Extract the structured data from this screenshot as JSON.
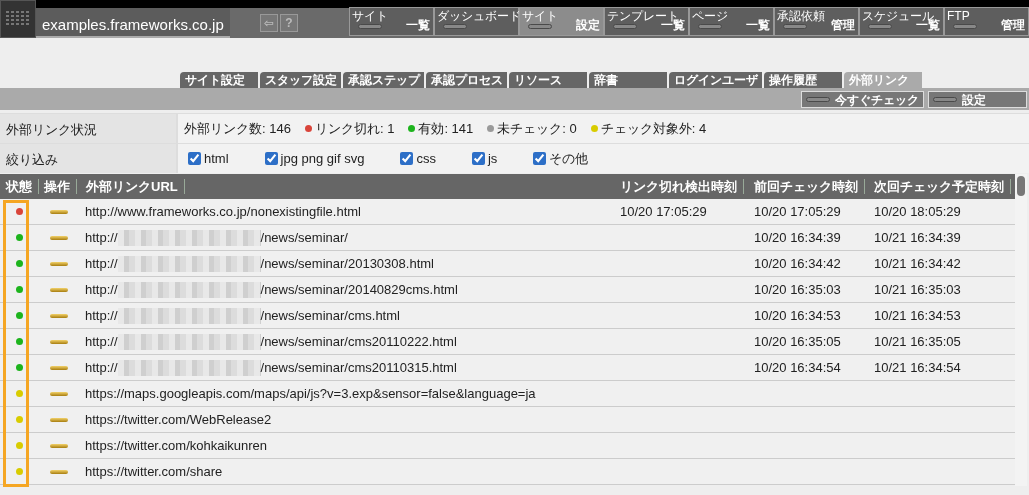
{
  "header": {
    "site_name": "examples.frameworks.co.jp",
    "tools": [
      "⇦",
      "?"
    ],
    "nav": [
      {
        "label": "サイト",
        "action": "一覧",
        "selected": false
      },
      {
        "label": "ダッシュボード",
        "selected": false
      },
      {
        "label": "サイト",
        "action": "設定",
        "selected": true
      },
      {
        "label": "テンプレート",
        "action": "一覧",
        "selected": false
      },
      {
        "label": "ページ",
        "action": "一覧",
        "selected": false
      },
      {
        "label": "承認依頼",
        "action": "管理",
        "selected": false
      },
      {
        "label": "スケジュール",
        "action": "一覧",
        "selected": false
      },
      {
        "label": "FTP",
        "action": "管理",
        "selected": false
      }
    ]
  },
  "tabs": [
    {
      "label": "サイト設定",
      "selected": false
    },
    {
      "label": "スタッフ設定",
      "selected": false
    },
    {
      "label": "承認ステップ",
      "selected": false
    },
    {
      "label": "承認プロセス",
      "selected": false
    },
    {
      "label": "リソース",
      "selected": false
    },
    {
      "label": "辞書",
      "selected": false
    },
    {
      "label": "ログインユーザ",
      "selected": false
    },
    {
      "label": "操作履歴",
      "selected": false
    },
    {
      "label": "外部リンク",
      "selected": true
    }
  ],
  "tab_buttons": [
    "今すぐチェック",
    "設定"
  ],
  "status_row": {
    "label": "外部リンク状況",
    "total": "外部リンク数: 146",
    "counts": [
      {
        "label": "リンク切れ: 1",
        "color": "#d9443a"
      },
      {
        "label": "有効: 141",
        "color": "#1db41d"
      },
      {
        "label": "未チェック: 0",
        "color": "#9a9a9a"
      },
      {
        "label": "チェック対象外: 4",
        "color": "#d8cc00"
      }
    ]
  },
  "filter_row": {
    "label": "絞り込み",
    "options": [
      {
        "label": "html",
        "checked": true
      },
      {
        "label": "jpg png gif svg",
        "checked": true
      },
      {
        "label": "css",
        "checked": true
      },
      {
        "label": "js",
        "checked": true
      },
      {
        "label": "その他",
        "checked": true
      }
    ]
  },
  "table": {
    "columns": [
      "状態",
      "操作",
      "外部リンクURL",
      "リンク切れ検出時刻",
      "前回チェック時刻",
      "次回チェック予定時刻"
    ],
    "rows": [
      {
        "color": "#d9443a",
        "redacted": false,
        "url_head": "http://www.frameworks.co.jp/nonexistingfile.html",
        "broken_at": "10/20 17:05:29",
        "last_check": "10/20 17:05:29",
        "next_check": "10/20 18:05:29"
      },
      {
        "color": "#1db41d",
        "redacted": true,
        "url_head": "http://",
        "url_tail": "/news/seminar/",
        "last_check": "10/20 16:34:39",
        "next_check": "10/21 16:34:39"
      },
      {
        "color": "#1db41d",
        "redacted": true,
        "url_head": "http://",
        "url_tail": "/news/seminar/20130308.html",
        "last_check": "10/20 16:34:42",
        "next_check": "10/21 16:34:42"
      },
      {
        "color": "#1db41d",
        "redacted": true,
        "url_head": "http://",
        "url_tail": "/news/seminar/20140829cms.html",
        "last_check": "10/20 16:35:03",
        "next_check": "10/21 16:35:03"
      },
      {
        "color": "#1db41d",
        "redacted": true,
        "url_head": "http://",
        "url_tail": "/news/seminar/cms.html",
        "last_check": "10/20 16:34:53",
        "next_check": "10/21 16:34:53"
      },
      {
        "color": "#1db41d",
        "redacted": true,
        "url_head": "http://",
        "url_tail": "/news/seminar/cms20110222.html",
        "last_check": "10/20 16:35:05",
        "next_check": "10/21 16:35:05"
      },
      {
        "color": "#1db41d",
        "redacted": true,
        "url_head": "http://",
        "url_tail": "/news/seminar/cms20110315.html",
        "last_check": "10/20 16:34:54",
        "next_check": "10/21 16:34:54"
      },
      {
        "color": "#d8cc00",
        "redacted": false,
        "url_head": "https://maps.googleapis.com/maps/api/js?v=3.exp&sensor=false&language=ja"
      },
      {
        "color": "#d8cc00",
        "redacted": false,
        "url_head": "https://twitter.com/WebRelease2"
      },
      {
        "color": "#d8cc00",
        "redacted": false,
        "url_head": "https://twitter.com/kohkaikunren"
      },
      {
        "color": "#d8cc00",
        "redacted": false,
        "url_head": "https://twitter.com/share"
      }
    ]
  }
}
